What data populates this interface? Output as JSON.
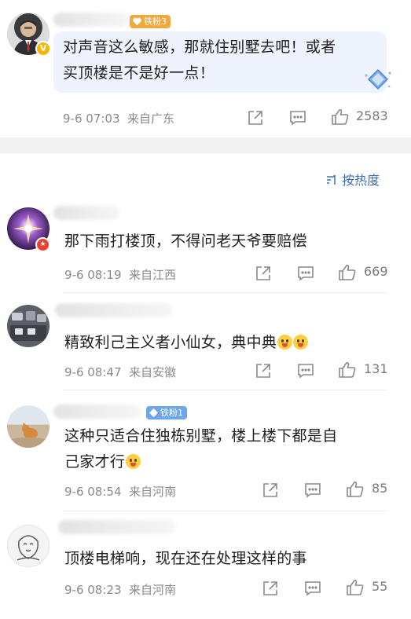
{
  "top_comment": {
    "badge": "铁粉3",
    "text": "对声音这么敏感，那就住别墅去吧！或者买顶楼是不是好一点！",
    "text_line1": "对声音这么敏感，那就住别墅去吧！或者",
    "text_line2": "买顶楼是不是好一点！",
    "time": "9-6 07:03",
    "location": "来自广东",
    "likes": "2583"
  },
  "sort": {
    "label": "按热度",
    "icon": "sort-icon"
  },
  "comments": [
    {
      "text": "那下雨打楼顶，不得问老天爷要赔偿",
      "time": "9-6 08:19",
      "location": "来自江西",
      "likes": "669"
    },
    {
      "text": "精致利己主义者小仙女，典中典",
      "time": "9-6 08:47",
      "location": "来自安徽",
      "likes": "131",
      "emojis": [
        "tongue-emoji",
        "tongue-emoji"
      ]
    },
    {
      "badge": "铁粉1",
      "text_line1": "这种只适合住独栋别墅，楼上楼下都是自",
      "text_line2": "己家才行",
      "time": "9-6 08:54",
      "location": "来自河南",
      "likes": "85",
      "emojis": [
        "laughing-crying-emoji"
      ]
    },
    {
      "text": "顶楼电梯响，现在还在处理这样的事",
      "time": "9-6 08:23",
      "location": "来自河南",
      "likes": "55"
    }
  ],
  "icons": {
    "share": "share-icon",
    "comment": "comment-icon",
    "like": "like-icon"
  },
  "colors": {
    "link_blue": "#3c6eb4",
    "meta_gray": "#8a8a8a",
    "bubble_bg": "#eef3fd",
    "fan_badge_gold": "#f0a93a",
    "fan_badge_blue": "#6fa6e8"
  }
}
